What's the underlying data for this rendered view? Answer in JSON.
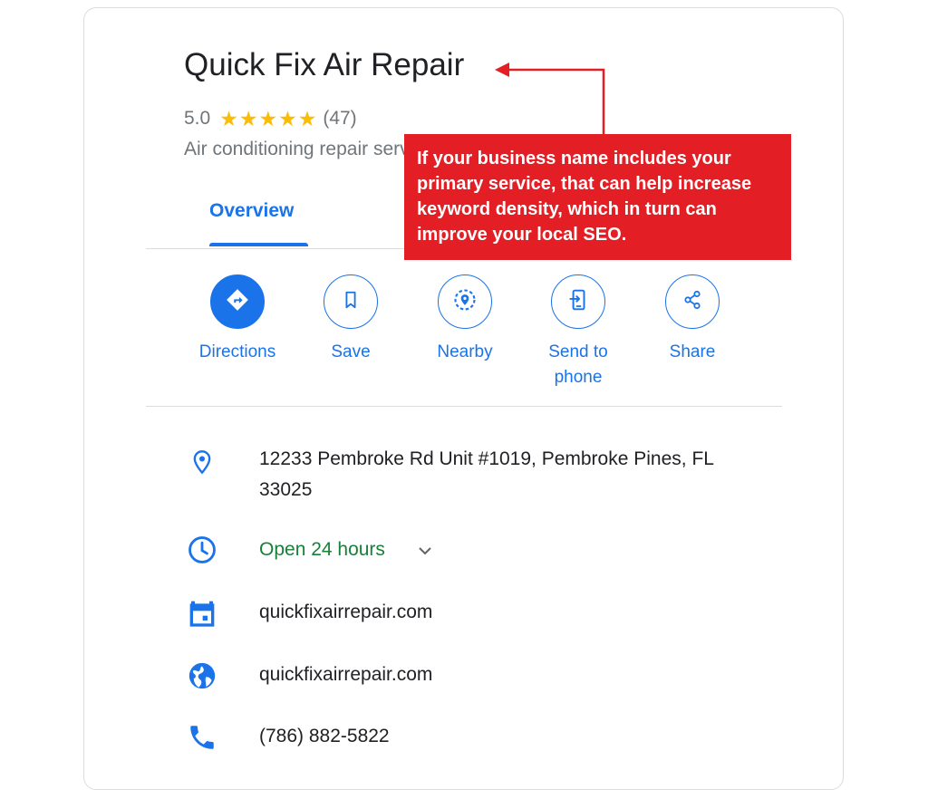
{
  "business": {
    "name": "Quick Fix Air Repair",
    "rating": "5.0",
    "stars": [
      "★",
      "★",
      "★",
      "★",
      "★"
    ],
    "review_count": "(47)",
    "category": "Air conditioning repair service"
  },
  "tabs": [
    {
      "label": "Overview",
      "active": true
    }
  ],
  "actions": [
    {
      "label": "Directions",
      "icon": "directions-icon"
    },
    {
      "label": "Save",
      "icon": "bookmark-icon"
    },
    {
      "label": "Nearby",
      "icon": "nearby-icon"
    },
    {
      "label": "Send to phone",
      "icon": "send-to-phone-icon"
    },
    {
      "label": "Share",
      "icon": "share-icon"
    }
  ],
  "info": {
    "address": "12233 Pembroke Rd Unit #1019, Pembroke Pines, FL 33025",
    "hours": "Open 24 hours",
    "appointment": "quickfixairrepair.com",
    "website": "quickfixairrepair.com",
    "phone": "(786) 882-5822"
  },
  "callout": {
    "text": "If your business name includes your primary service, that can help increase keyword density, which in turn can improve your local SEO."
  },
  "colors": {
    "accent": "#1a73e8",
    "star": "#fbbc04",
    "open": "#188038",
    "callout": "#e31e24",
    "muted": "#70757a"
  }
}
